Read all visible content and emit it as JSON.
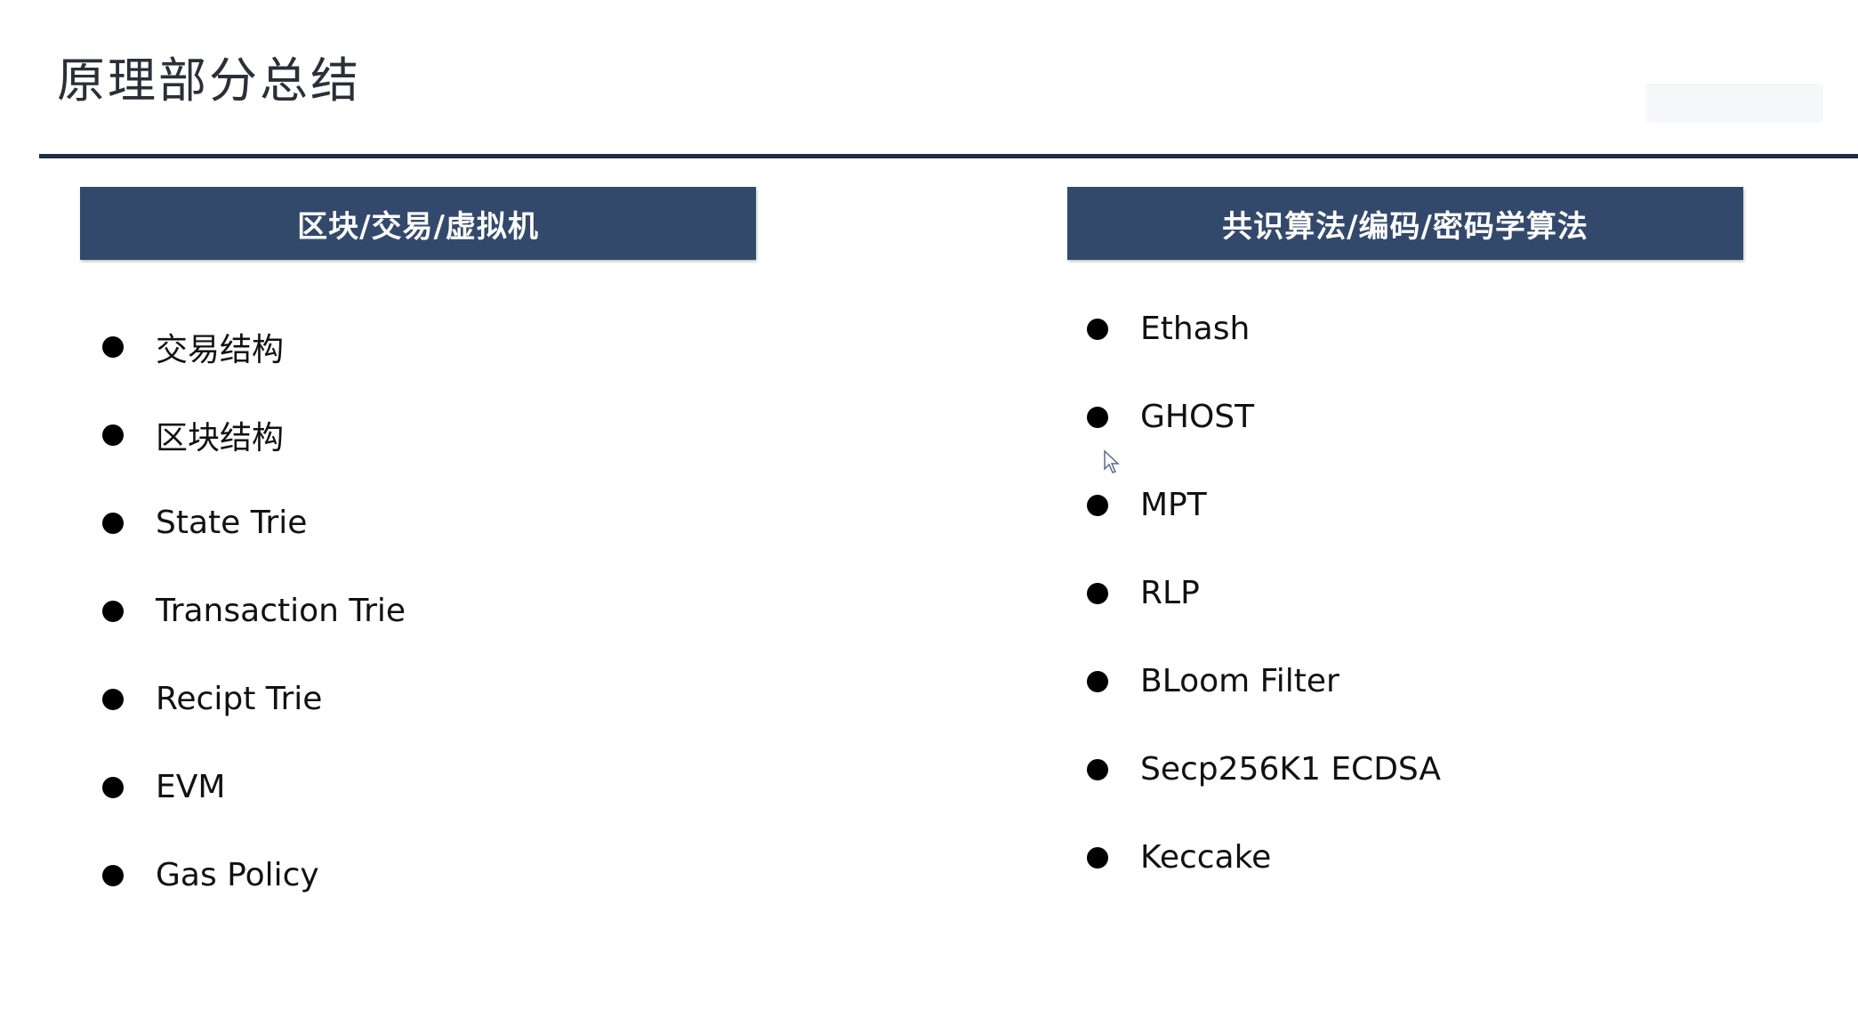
{
  "slide": {
    "title": "原理部分总结"
  },
  "left_panel": {
    "header": "区块/交易/虚拟机",
    "items": [
      "交易结构",
      "区块结构",
      "State Trie",
      "Transaction Trie",
      "Recipt Trie",
      "EVM",
      "Gas Policy"
    ]
  },
  "right_panel": {
    "header": "共识算法/编码/密码学算法",
    "items": [
      "Ethash",
      "GHOST",
      "MPT",
      "RLP",
      "BLoom Filter",
      "Secp256K1 ECDSA",
      "Keccake"
    ]
  },
  "colors": {
    "header_bg": "#33496b",
    "rule": "#1f2d45",
    "title_text": "#2a2f38"
  }
}
